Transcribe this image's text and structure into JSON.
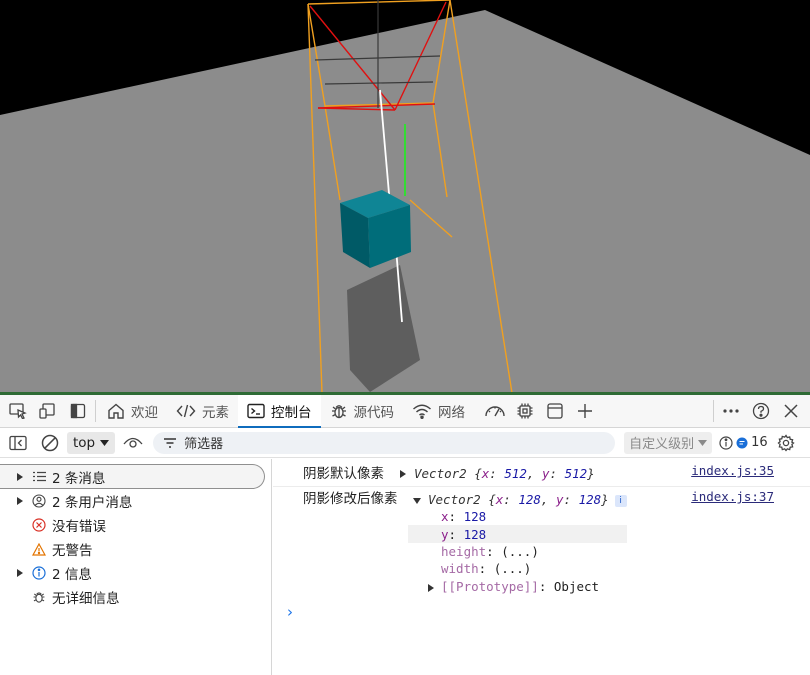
{
  "devtools": {
    "tabs": [
      {
        "label": "欢迎",
        "icon": "home-icon"
      },
      {
        "label": "元素",
        "icon": "code-icon"
      },
      {
        "label": "控制台",
        "icon": "console-icon",
        "active": true
      },
      {
        "label": "源代码",
        "icon": "bug-icon"
      },
      {
        "label": "网络",
        "icon": "wifi-icon"
      }
    ],
    "more_icons": [
      "performance-icon",
      "memory-icon",
      "application-icon",
      "plus-icon"
    ],
    "right_icons": [
      "more-icon",
      "help-icon",
      "close-icon"
    ]
  },
  "toolbar": {
    "context": "top",
    "filter_placeholder": "筛选器",
    "level": "自定义级别",
    "issues_count": "16"
  },
  "sidebar": {
    "items": [
      {
        "label": "2 条消息",
        "icon": "list-icon",
        "expandable": true,
        "selected": true
      },
      {
        "label": "2 条用户消息",
        "icon": "user-icon",
        "expandable": true
      },
      {
        "label": "没有错误",
        "icon": "error-icon",
        "expandable": false
      },
      {
        "label": "无警告",
        "icon": "warning-icon",
        "expandable": false
      },
      {
        "label": "2 信息",
        "icon": "info-icon",
        "expandable": true
      },
      {
        "label": "无详细信息",
        "icon": "bug-icon",
        "expandable": false
      }
    ]
  },
  "console": {
    "entries": [
      {
        "message": "阴影默认像素",
        "object": "Vector2 {x: 512, y: 512}",
        "type": "Vector2",
        "x": "512",
        "y": "512",
        "source": "index.js:35"
      },
      {
        "message": "阴影修改后像素",
        "object": "Vector2 {x: 128, y: 128}",
        "type": "Vector2",
        "x": "128",
        "y": "128",
        "source": "index.js:37",
        "properties": [
          {
            "key": "x",
            "value": "128"
          },
          {
            "key": "y",
            "value": "128"
          },
          {
            "key": "height",
            "value": "(...)"
          },
          {
            "key": "width",
            "value": "(...)"
          },
          {
            "key": "[[Prototype]]",
            "value": "Object"
          }
        ]
      }
    ],
    "prompt": "›"
  },
  "colors": {
    "accent": "#0f6cbd",
    "viewport_border": "#2e6b35",
    "ground": "#8c8c8c",
    "cube": "#006d7a"
  }
}
